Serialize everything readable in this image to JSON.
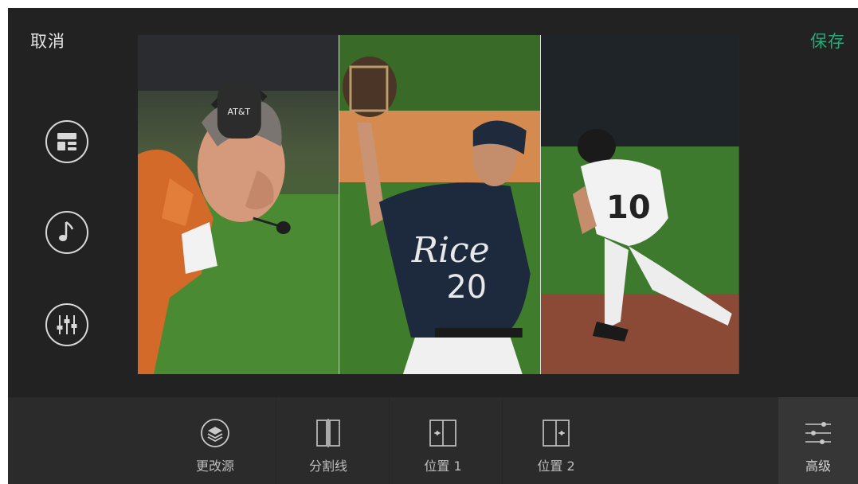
{
  "header": {
    "cancel_label": "取消",
    "save_label": "保存"
  },
  "side_tools": [
    {
      "icon": "layout-icon"
    },
    {
      "icon": "music-note-icon"
    },
    {
      "icon": "equalizer-icon"
    }
  ],
  "preview": {
    "panels": [
      {
        "icon": "coach-photo"
      },
      {
        "icon": "catcher-photo",
        "jersey_text": "Rice",
        "jersey_number": "20"
      },
      {
        "icon": "runner-photo",
        "jersey_number": "10"
      }
    ],
    "headset_brand": "AT&T"
  },
  "toolbar": {
    "items": [
      {
        "label": "更改源",
        "icon": "layers-icon"
      },
      {
        "label": "分割线",
        "icon": "split-line-icon"
      },
      {
        "label": "位置 1",
        "icon": "position-1-icon"
      },
      {
        "label": "位置 2",
        "icon": "position-2-icon"
      }
    ],
    "advanced_label": "高级"
  },
  "colors": {
    "background": "#222222",
    "toolbar": "#2b2b2b",
    "accent": "#2fa57a",
    "text": "#e6e6e6"
  }
}
